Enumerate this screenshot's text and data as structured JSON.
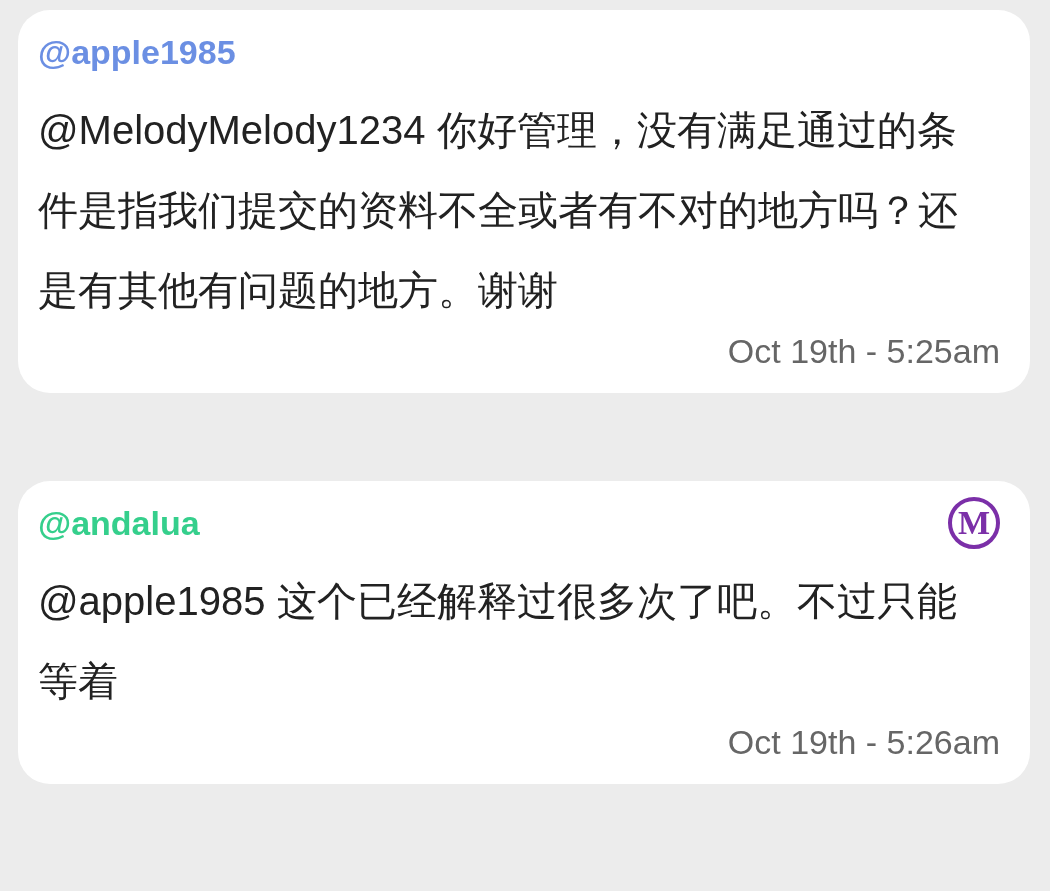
{
  "posts": [
    {
      "username": "@apple1985",
      "color": "#6b8fe3",
      "moderator": false,
      "text": "@MelodyMelody1234 你好管理，没有满足通过的条件是指我们提交的资料不全或者有不对的地方吗？还是有其他有问题的地方。谢谢",
      "time": "Oct 19th - 5:25am"
    },
    {
      "username": "@andalua",
      "color": "#35cf8c",
      "moderator": true,
      "badge": "M",
      "text": "@apple1985 这个已经解释过很多次了吧。不过只能等着",
      "time": "Oct 19th - 5:26am"
    }
  ]
}
